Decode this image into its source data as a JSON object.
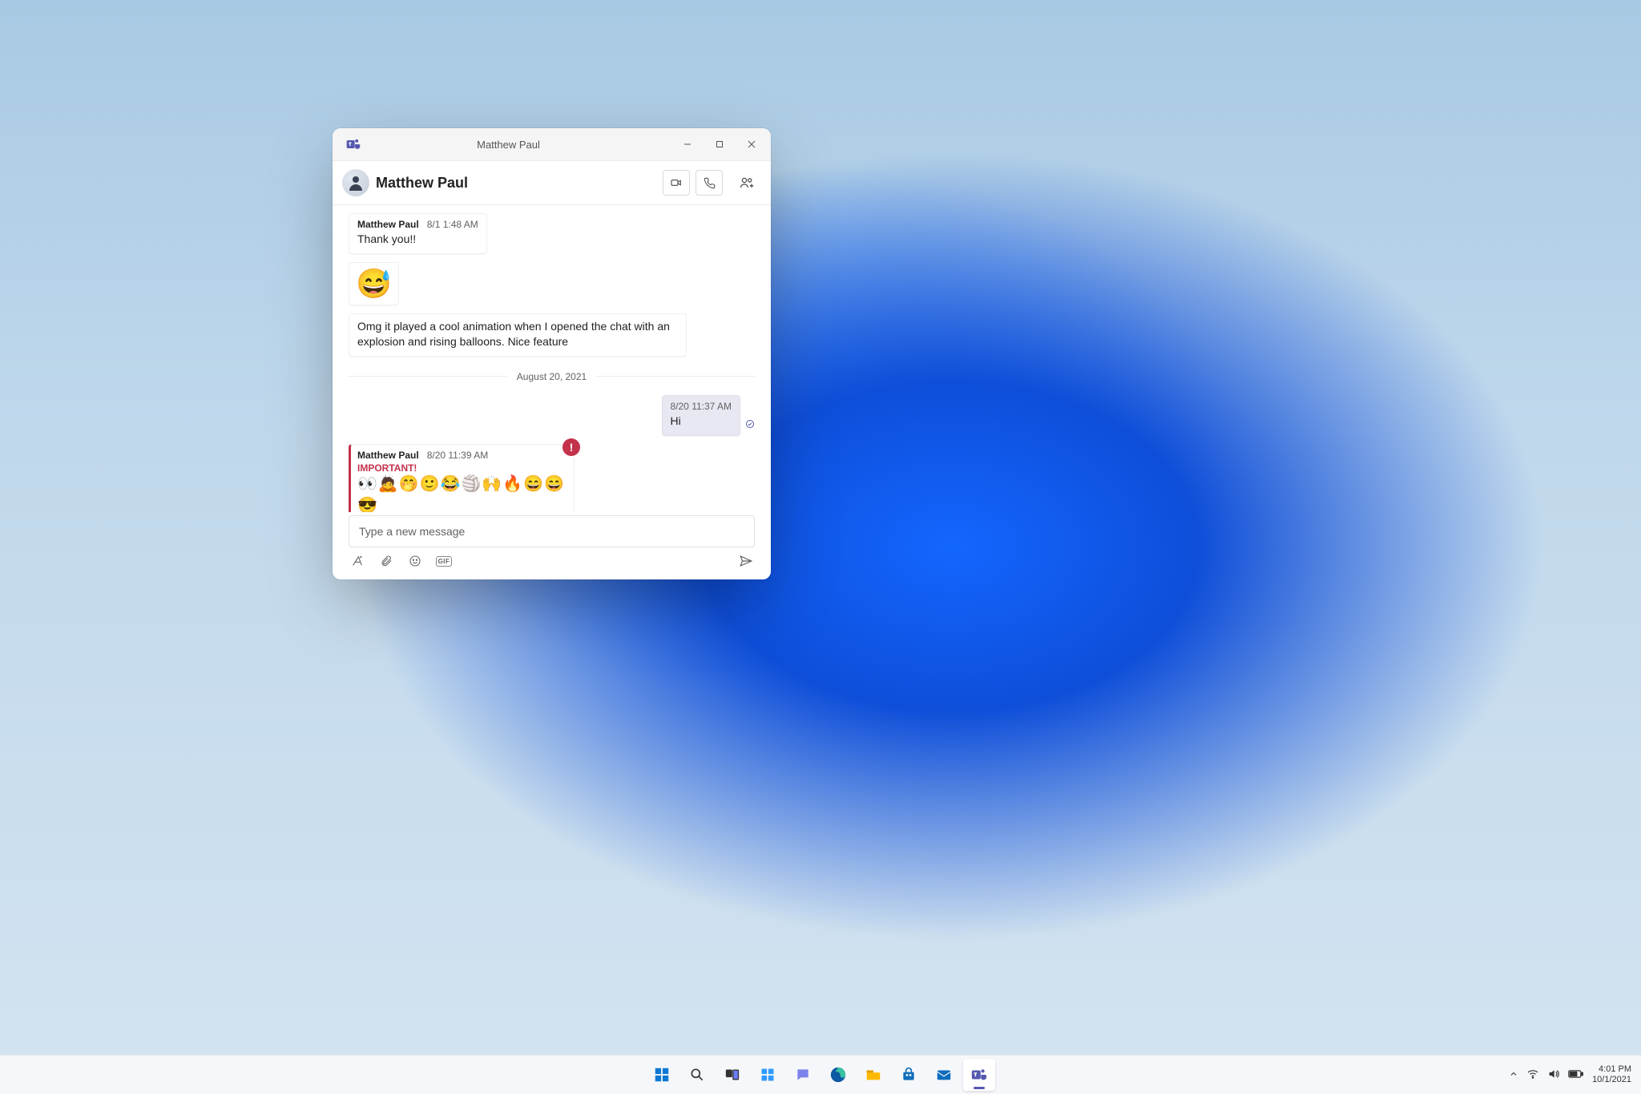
{
  "window": {
    "title": "Matthew Paul"
  },
  "chat": {
    "name": "Matthew Paul",
    "actions": {
      "video": "video-call",
      "audio": "audio-call",
      "people": "add-people"
    }
  },
  "messages": {
    "m1": {
      "author": "Matthew Paul",
      "time": "8/1 1:48 AM",
      "body": "Thank you!!"
    },
    "m2": {
      "emoji": "😅"
    },
    "m3": {
      "body": "Omg it played a cool animation when I opened the chat with an explosion and rising balloons. Nice feature"
    },
    "dateSep": "August 20, 2021",
    "m4": {
      "time": "8/20 11:37 AM",
      "body": "Hi"
    },
    "m5": {
      "author": "Matthew Paul",
      "time": "8/20 11:39 AM",
      "important": "IMPORTANT!",
      "body": "👀🙇🤭🙂😂🏐🙌🔥😄😄😎"
    }
  },
  "compose": {
    "placeholder": "Type a new message",
    "gif": "GIF"
  },
  "taskbar": {
    "time": "4:01 PM",
    "date": "10/1/2021"
  }
}
